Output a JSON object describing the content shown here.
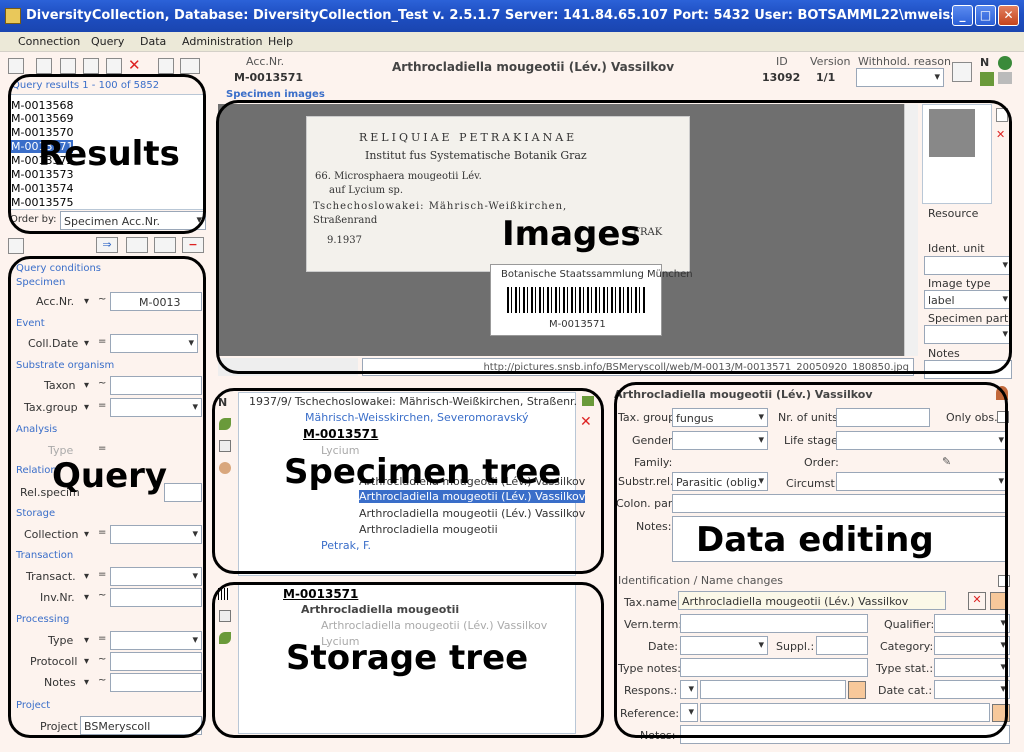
{
  "window": {
    "title": "DiversityCollection,  Database: DiversityCollection_Test    v. 2.5.1.7   Server: 141.84.65.107   Port: 5432   User: BOTSAMML22\\mweiss"
  },
  "menu": [
    "Connection",
    "Query",
    "Data",
    "Administration",
    "Help"
  ],
  "header": {
    "acc_label": "Acc.Nr.",
    "acc_value": "M-0013571",
    "taxon_title": "Arthrocladiella mougeotii (Lév.) Vassilkov",
    "id_label": "ID",
    "id_value": "13092",
    "version_label": "Version",
    "version_value": "1/1",
    "withhold_label": "Withhold. reason"
  },
  "results": {
    "header": "Query results   1 - 100 of 5852",
    "items": [
      "M-0013568",
      "M-0013569",
      "M-0013570",
      "M-0013571",
      "M-0013572",
      "M-0013573",
      "M-0013574",
      "M-0013575"
    ],
    "selected_index": 3,
    "order_label": "Order by:",
    "order_value": "Specimen Acc.Nr."
  },
  "query": {
    "title": "Query conditions",
    "sections": [
      {
        "name": "Specimen",
        "rows": [
          {
            "label": "Acc.Nr.",
            "op": "~",
            "value": "M-0013"
          }
        ]
      },
      {
        "name": "Event",
        "rows": [
          {
            "label": "Coll.Date",
            "op": "=",
            "value": ""
          }
        ]
      },
      {
        "name": "Substrate organism",
        "rows": [
          {
            "label": "Taxon",
            "op": "~",
            "value": ""
          },
          {
            "label": "Tax.group",
            "op": "=",
            "value": ""
          }
        ]
      },
      {
        "name": "Analysis",
        "rows": [
          {
            "label": "Type",
            "op": "=",
            "value": ""
          }
        ]
      },
      {
        "name": "Relation",
        "rows": [
          {
            "label": "Rel.specim",
            "op": "~",
            "value": ""
          }
        ]
      },
      {
        "name": "Storage",
        "rows": [
          {
            "label": "Collection",
            "op": "=",
            "value": ""
          }
        ]
      },
      {
        "name": "Transaction",
        "rows": [
          {
            "label": "Transact.",
            "op": "=",
            "value": ""
          },
          {
            "label": "Inv.Nr.",
            "op": "~",
            "value": ""
          }
        ]
      },
      {
        "name": "Processing",
        "rows": [
          {
            "label": "Type",
            "op": "=",
            "value": ""
          },
          {
            "label": "Protocoll",
            "op": "~",
            "value": ""
          },
          {
            "label": "Notes",
            "op": "~",
            "value": ""
          }
        ]
      },
      {
        "name": "Project",
        "rows": [
          {
            "label": "Project",
            "op": "",
            "value": "BSMeryscoll"
          }
        ]
      }
    ]
  },
  "images": {
    "section": "Specimen images",
    "url": "http://pictures.snsb.info/BSMeryscoll/web/M-0013/M-0013571_20050920_180850.jpg",
    "label_lines": [
      "RELIQUIAE PETRAKIANAE",
      "Institut fus Systematische Botanik Graz",
      "66. Microsphaera mougeotii Lév.",
      "auf  Lycium  sp.",
      "Tschechoslowakei: Mährisch-Weißkirchen,",
      "Straßenrand",
      "9.1937",
      "FRAK"
    ],
    "stamp_lines": [
      "Botanische Staatssammlung München",
      "M-0013571"
    ],
    "side": {
      "resource": "Resource",
      "ident_unit": "Ident. unit",
      "image_type": "Image type",
      "image_type_value": "label",
      "specimen_part": "Specimen part:",
      "notes": "Notes"
    }
  },
  "specimen_tree": {
    "nodes": [
      "1937/9/ Tschechoslowakei: Mährisch-Weißkirchen, Straßenr.",
      "Mährisch-Weisskirchen, Severomoravský",
      "M-0013571",
      "Lycium",
      "Arthrocladiella mougeotii (Lév.) Vassilkov",
      "Arthrocladiella mougeotii (Lév.) Vassilkov",
      "Arthrocladiella mougeotii (Lév.) Vassilkov",
      "Arthrocladiella mougeotii",
      "Petrak, F."
    ]
  },
  "storage_tree": {
    "nodes": [
      "M-0013571",
      "Arthrocladiella mougeotii",
      "Arthrocladiella mougeotii (Lév.) Vassilkov",
      "Lycium"
    ]
  },
  "editing": {
    "title": "Arthrocladiella mougeotii (Lév.) Vassilkov",
    "tax_group_label": "Tax. group:",
    "tax_group_value": "fungus",
    "nr_units_label": "Nr. of units:",
    "only_obs_label": "Only obs.",
    "gender_label": "Gender:",
    "life_stage_label": "Life stage:",
    "family_label": "Family:",
    "order_label": "Order:",
    "substr_label": "Substr.rel.:",
    "substr_value": "Parasitic (oblig.",
    "circumst_label": "Circumst.:",
    "colon_label": "Colon. part:",
    "notes_label": "Notes:",
    "ident_section": "Identification / Name changes",
    "taxname_label": "Tax.name:",
    "taxname_value": "Arthrocladiella mougeotii (Lév.) Vassilkov",
    "vern_label": "Vern.term:",
    "qualifier_label": "Qualifier:",
    "date_label": "Date:",
    "suppl_label": "Suppl.:",
    "category_label": "Category:",
    "type_notes_label": "Type notes:",
    "type_stat_label": "Type stat.:",
    "respons_label": "Respons.:",
    "date_cat_label": "Date cat.:",
    "reference_label": "Reference:",
    "notes2_label": "Notes:"
  },
  "overlays": {
    "results": "Results",
    "images": "Images",
    "query": "Query",
    "specimen_tree": "Specimen tree",
    "data_editing": "Data editing",
    "storage_tree": "Storage tree"
  }
}
